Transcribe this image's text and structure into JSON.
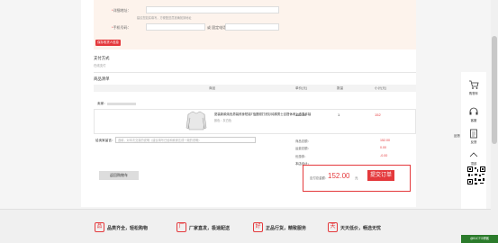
{
  "address": {
    "star": "*",
    "detail_label": "详细地址：",
    "detail_hint": "建议您如实填写，方便配送员准确找到地址",
    "phone_label": "手机号码：",
    "landline_label": "或 固定电话：",
    "save_label": "保存收货人信息"
  },
  "payment": {
    "title": "支付方式",
    "method": "在线支付"
  },
  "goods": {
    "title": "商品清单",
    "columns": [
      "商品",
      "单价(元)",
      "数量",
      "小计(元)"
    ],
    "seller_label": "卖家：",
    "item": {
      "title": "夏装新款纯色男装修身短袖T恤圆领打底衫纯棉男士百搭休闲上衣男半袖",
      "attrs": "颜色：灰白色",
      "price": "152.00",
      "qty": "1",
      "subtotal": "152"
    }
  },
  "remark": {
    "label": "给卖家留言：",
    "placeholder": "选填，对本次交易的说明（建议填写已经和卖家达成一致的说明）"
  },
  "summary": {
    "goods_total_label": "商品总额：",
    "goods_total": "152.00",
    "freight_label": "运费总额：",
    "freight": "0.00",
    "discount_label": "优惠券：",
    "discount": "-0.00",
    "shop_total_label": "本店合计："
  },
  "actions": {
    "back_label": "返回购物车",
    "payable_label": "应付总金额：",
    "payable_amount": "152.00",
    "payable_unit": "元",
    "submit_label": "提交订单"
  },
  "toolbar": {
    "cart": "购物车",
    "service": "客服",
    "feedback": "反馈",
    "top": "顶部",
    "side": "反馈",
    "app": "扫我下载App"
  },
  "footer": {
    "badges": [
      "品",
      "厂",
      "好",
      "天"
    ],
    "items": [
      "品类齐全，轻松购物",
      "厂家直发，极速配送",
      "正品行货，精致服务",
      "天天低价，畅选无忧"
    ]
  },
  "watermark": "@51CTO博客",
  "colors": {
    "accent": "#e4393c",
    "form_background": "#fdf3ec"
  }
}
